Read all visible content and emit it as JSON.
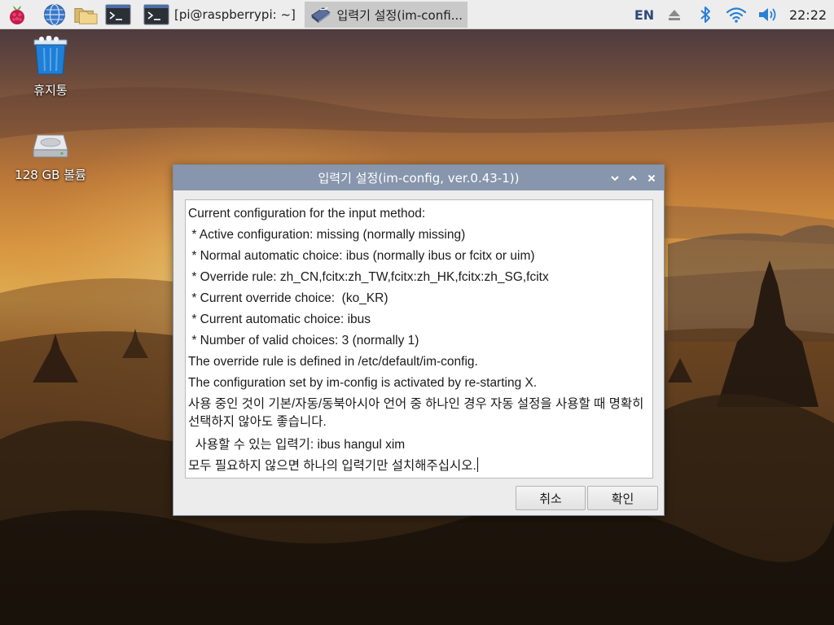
{
  "taskbar": {
    "launchers": [
      {
        "name": "raspberry-menu-icon"
      },
      {
        "name": "web-browser-icon"
      },
      {
        "name": "file-manager-icon"
      },
      {
        "name": "terminal-icon"
      }
    ],
    "tasks": [
      {
        "label": "[pi@raspberrypi: ~]",
        "icon": "terminal-icon",
        "active": false
      },
      {
        "label": "입력기 설정(im-confi...",
        "icon": "im-config-icon",
        "active": true
      }
    ],
    "tray": {
      "language": "EN",
      "clock": "22:22",
      "icons": [
        "eject-icon",
        "bluetooth-icon",
        "wifi-icon",
        "volume-icon"
      ]
    }
  },
  "desktop": {
    "icons": [
      {
        "label": "휴지통",
        "icon": "trash-icon"
      },
      {
        "label": "128 GB 볼륨",
        "icon": "drive-icon"
      }
    ]
  },
  "dialog": {
    "title": "입력기 설정(im-config, ver.0.43-1))",
    "lines": [
      "Current configuration for the input method:",
      " * Active configuration: missing (normally missing)",
      " * Normal automatic choice: ibus (normally ibus or fcitx or uim)",
      " * Override rule: zh_CN,fcitx:zh_TW,fcitx:zh_HK,fcitx:zh_SG,fcitx",
      " * Current override choice:  (ko_KR)",
      " * Current automatic choice: ibus",
      " * Number of valid choices: 3 (normally 1)",
      "The override rule is defined in /etc/default/im-config.",
      "The configuration set by im-config is activated by re-starting X.",
      "사용 중인 것이 기본/자동/동북아시아 언어 중 하나인 경우 자동 설정을 사용할 때 명확히 선택하지 않아도 좋습니다.",
      "  사용할 수 있는 입력기: ibus hangul xim",
      "모두 필요하지 않으면 하나의 입력기만 설치해주십시오."
    ],
    "cancel_label": "취소",
    "ok_label": "확인"
  },
  "colors": {
    "taskbar_bg": "#ededed",
    "dialog_titlebar": "#8796ad",
    "dialog_bg": "#ececec",
    "lang_text": "#2f4a7a",
    "tray_icon_blue": "#2a7fd4"
  }
}
